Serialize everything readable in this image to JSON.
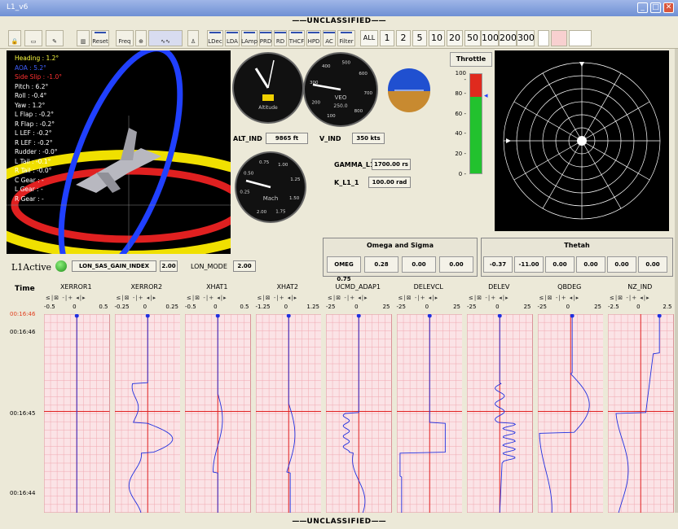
{
  "window": {
    "title": "L1_v6"
  },
  "classification": {
    "top": "UNCLASSIFIED",
    "bottom": "UNCLASSIFIED"
  },
  "toolbar": {
    "buttons": [
      "Reset",
      "Freq",
      "LDec",
      "LDA",
      "LAmp",
      "PRD",
      "RD",
      "THCF",
      "HPD",
      "AC",
      "Filter"
    ],
    "all_label": "ALL",
    "rates": [
      "1",
      "2",
      "5",
      "10",
      "20",
      "50",
      "100",
      "200",
      "300"
    ]
  },
  "hud": {
    "lines": [
      {
        "text": "Heading : 1.2°",
        "color": "#ffff40"
      },
      {
        "text": "AOA : 5.2°",
        "color": "#4060ff"
      },
      {
        "text": "Side Slip : -1.0°",
        "color": "#ff3030"
      },
      {
        "text": "Pitch : 6.2°",
        "color": "#ffffff"
      },
      {
        "text": "Roll : -0.4°",
        "color": "#ffffff"
      },
      {
        "text": "Yaw : 1.2°",
        "color": "#ffffff"
      },
      {
        "text": "L Flap : -0.2°",
        "color": "#ffffff"
      },
      {
        "text": "R Flap : -0.2°",
        "color": "#ffffff"
      },
      {
        "text": "L LEF : -0.2°",
        "color": "#ffffff"
      },
      {
        "text": "R LEF : -0.2°",
        "color": "#ffffff"
      },
      {
        "text": "Rudder : -0.0°",
        "color": "#ffffff"
      },
      {
        "text": "L Tail : -0.1°",
        "color": "#ffffff"
      },
      {
        "text": "R Tail : -0.0°",
        "color": "#ffffff"
      },
      {
        "text": "C Gear : -",
        "color": "#ffffff"
      },
      {
        "text": "L Gear : -",
        "color": "#ffffff"
      },
      {
        "text": "R Gear : -",
        "color": "#ffffff"
      }
    ]
  },
  "gauges": {
    "altimeter_label": "Altitude",
    "veo_label": "VEO",
    "veo_value": "250.0",
    "veo_ticks": [
      "100",
      "200",
      "300",
      "400",
      "500",
      "600",
      "700",
      "800"
    ],
    "mach_label": "Mach",
    "mach_ticks": [
      "0.25",
      "0.50",
      "0.75",
      "1.00",
      "1.25",
      "1.50",
      "1.75",
      "2.00"
    ]
  },
  "readouts": {
    "alt_label": "ALT_IND",
    "alt_value": "9865 ft",
    "v_label": "V_IND",
    "v_value": "350 kts",
    "gamma_label": "GAMMA_L1",
    "gamma_value": "1700.00 rs",
    "k_label": "K_L1_1",
    "k_value": "100.00 rad"
  },
  "throttle": {
    "title": "Throttle",
    "ticks": [
      "100",
      "80",
      "60",
      "40",
      "20",
      "0"
    ],
    "level_percent": 77,
    "red_top_percent": 100
  },
  "status": {
    "l1active_label": "L1Active",
    "lon_sas_label": "LON_SAS_GAIN_INDEX",
    "lon_sas_value": "2.00",
    "lon_mode_label": "LON_MODE",
    "lon_mode_value": "2.00"
  },
  "omega_sigma": {
    "title": "Omega and Sigma",
    "label": "OMEG 0.75",
    "values": [
      "0.28",
      "0.00",
      "0.00"
    ]
  },
  "thetah": {
    "title": "Thetah",
    "values": [
      "-0.37",
      "-11.00",
      "0.00",
      "0.00",
      "0.00",
      "0.00"
    ]
  },
  "strip": {
    "time_header": "Time",
    "times": [
      "00:16:46",
      "00:16:46",
      "00:16:45",
      "00:16:44"
    ],
    "ctrl": "≤|⊠ -|+ ◂|▸",
    "channels": [
      {
        "name": "XERROR1",
        "min": "-0.5",
        "mid": "0",
        "max": "0.5"
      },
      {
        "name": "XERROR2",
        "min": "-0.25",
        "mid": "0",
        "max": "0.25"
      },
      {
        "name": "XHAT1",
        "min": "-0.5",
        "mid": "0",
        "max": "0.5"
      },
      {
        "name": "XHAT2",
        "min": "-1.25",
        "mid": "0",
        "max": "1.25"
      },
      {
        "name": "UCMD_ADAP1",
        "min": "-25",
        "mid": "0",
        "max": "25"
      },
      {
        "name": "DELEVCL",
        "min": "-25",
        "mid": "0",
        "max": "25"
      },
      {
        "name": "DELEV",
        "min": "-25",
        "mid": "0",
        "max": "25"
      },
      {
        "name": "QBDEG",
        "min": "-25",
        "mid": "0",
        "max": "25"
      },
      {
        "name": "NZ_IND",
        "min": "-2.5",
        "mid": "0",
        "max": "2.5"
      }
    ]
  }
}
